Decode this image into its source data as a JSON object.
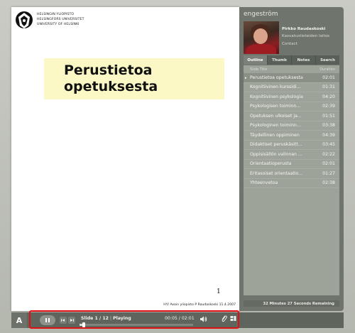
{
  "slide": {
    "logo_lines": [
      "HELSINGIN YLIOPISTO",
      "HELSINGFORS UNIVERSITET",
      "UNIVERSITY OF HELSINKI"
    ],
    "title": "Perustietoa\nopetuksesta",
    "page_number": "1",
    "footer_note": "HY/ Avoin yliopisto P Raudaskoski 11.4.2007"
  },
  "panel": {
    "presenter_name": "engeström",
    "speaker_name": "Pirkko Raudaskoski",
    "speaker_title": "Kasvatustieteiden laitos",
    "contact_label": "Contact",
    "tabs": [
      {
        "label": "Outline",
        "active": true
      },
      {
        "label": "Thumb",
        "active": false
      },
      {
        "label": "Notes",
        "active": false
      },
      {
        "label": "Search",
        "active": false
      }
    ],
    "list_header": {
      "title": "Slide Title",
      "duration": "Duration"
    },
    "slides": [
      {
        "title": "Perustietoa opetuksesta",
        "duration": "02:01",
        "current": true
      },
      {
        "title": "Kognitiivinen kurssidi...",
        "duration": "01:31",
        "current": false
      },
      {
        "title": "Kognitiivinen psykologia",
        "duration": "04:20",
        "current": false
      },
      {
        "title": "Psykologisen toiminn...",
        "duration": "02:39",
        "current": false
      },
      {
        "title": "Opetuksen ulkoiset ja...",
        "duration": "01:51",
        "current": false
      },
      {
        "title": "Psykologinen toiminn...",
        "duration": "03:38",
        "current": false
      },
      {
        "title": "Täydellinen oppiminen",
        "duration": "04:39",
        "current": false
      },
      {
        "title": "Didaktiset peruskäsitt...",
        "duration": "03:45",
        "current": false
      },
      {
        "title": "Oppisisällön valinnan ...",
        "duration": "02:22",
        "current": false
      },
      {
        "title": "Orientaatioperusta",
        "duration": "02:01",
        "current": false
      },
      {
        "title": "Eritasoiset orientaatio...",
        "duration": "01:27",
        "current": false
      },
      {
        "title": "Yhteenvetoa",
        "duration": "02:38",
        "current": false
      }
    ],
    "remaining": "32 Minutes 27 Seconds Remaining"
  },
  "controls": {
    "adobe_label": "A",
    "play_pause_icon": "pause-icon",
    "prev_icon": "previous-icon",
    "next_icon": "next-icon",
    "slide_status": "Slide 1 / 12",
    "separator": "|",
    "playback_state": "Playing",
    "time": "00:05 / 02:01",
    "progress_fraction": 0.04,
    "volume_icon": "speaker-icon",
    "attachment_icon": "paperclip-icon",
    "layout_icon": "layout-icon"
  },
  "colors": {
    "highlight_border": "#e01010",
    "title_box_bg": "#fbf8c5",
    "panel_bg": "#6f746c"
  }
}
